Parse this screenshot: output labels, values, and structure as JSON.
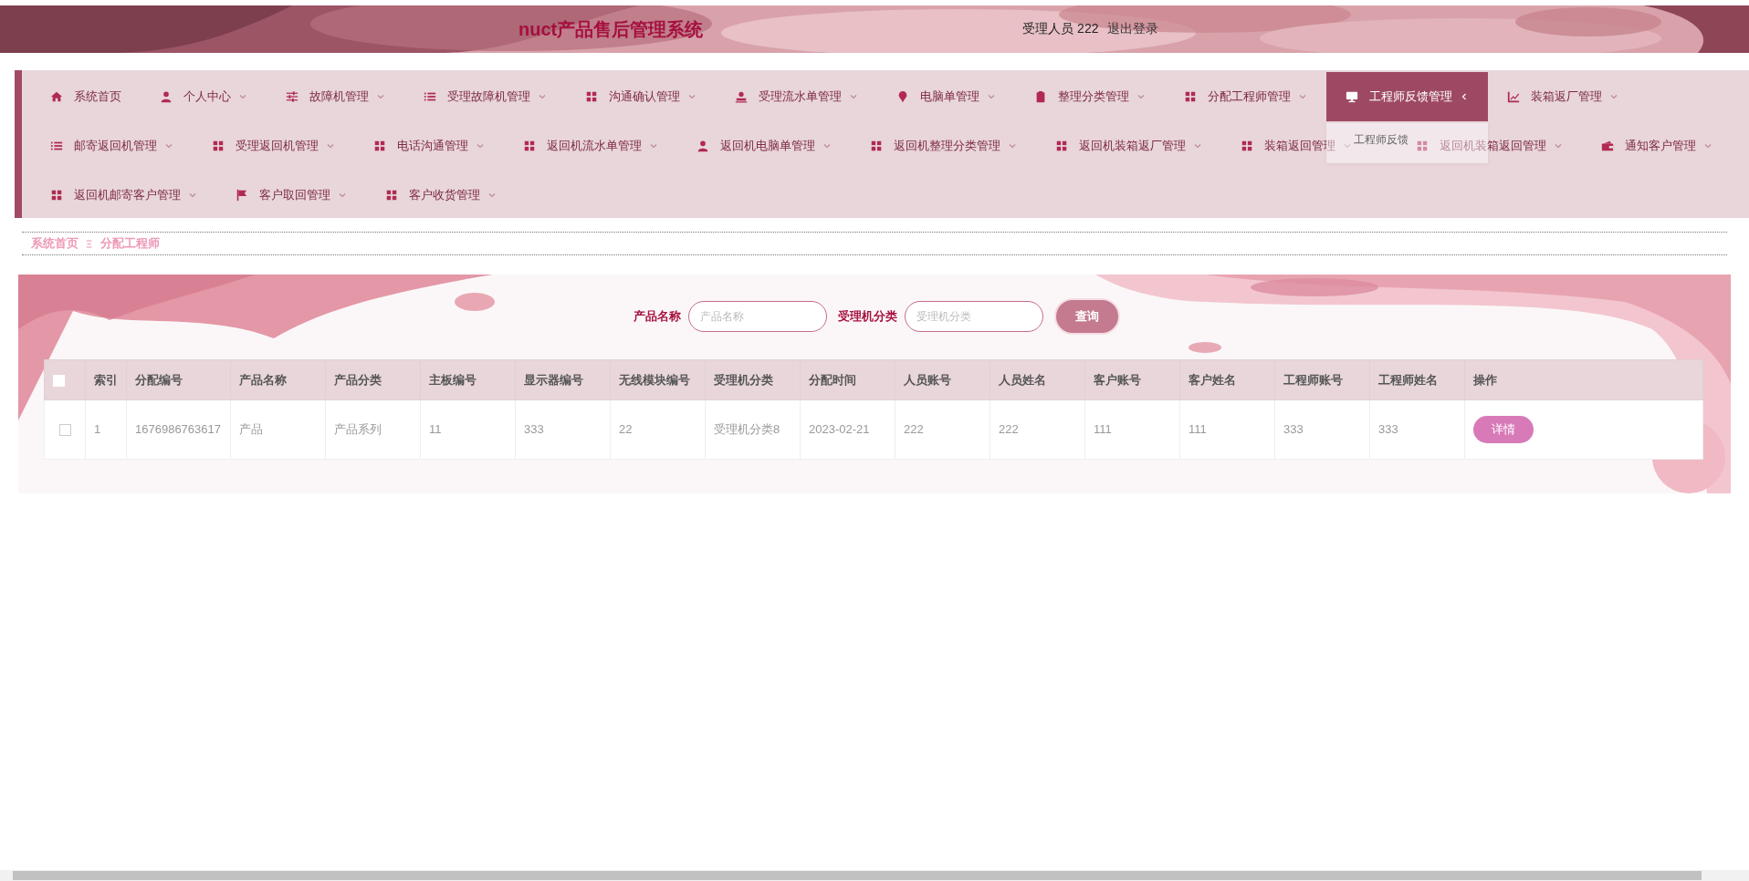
{
  "header": {
    "title": "nuct产品售后管理系统",
    "user_label": "受理人员",
    "user_name": "222",
    "logout": "退出登录"
  },
  "menu_rows": [
    {
      "items": [
        {
          "label": "系统首页",
          "has_submenu": false,
          "selected": false,
          "expanded": false
        },
        {
          "label": "个人中心",
          "has_submenu": true,
          "selected": false,
          "expanded": false
        },
        {
          "label": "故障机管理",
          "has_submenu": true,
          "selected": false,
          "expanded": false
        },
        {
          "label": "受理故障机管理",
          "has_submenu": true,
          "selected": false,
          "expanded": false
        },
        {
          "label": "沟通确认管理",
          "has_submenu": true,
          "selected": false,
          "expanded": false
        },
        {
          "label": "受理流水单管理",
          "has_submenu": true,
          "selected": false,
          "expanded": false
        },
        {
          "label": "电脑单管理",
          "has_submenu": true,
          "selected": false,
          "expanded": false
        },
        {
          "label": "整理分类管理",
          "has_submenu": true,
          "selected": false,
          "expanded": false
        },
        {
          "label": "分配工程师管理",
          "has_submenu": true,
          "selected": false,
          "expanded": false
        },
        {
          "label": "工程师反馈管理",
          "has_submenu": true,
          "selected": true,
          "expanded": true,
          "submenu": [
            "工程师反馈"
          ]
        },
        {
          "label": "装箱返厂管理",
          "has_submenu": true,
          "selected": false,
          "expanded": false
        }
      ]
    },
    {
      "items": [
        {
          "label": "邮寄返回机管理",
          "has_submenu": true,
          "selected": false,
          "expanded": false
        },
        {
          "label": "受理返回机管理",
          "has_submenu": true,
          "selected": false,
          "expanded": false
        },
        {
          "label": "电话沟通管理",
          "has_submenu": true,
          "selected": false,
          "expanded": false
        },
        {
          "label": "返回机流水单管理",
          "has_submenu": true,
          "selected": false,
          "expanded": false
        },
        {
          "label": "返回机电脑单管理",
          "has_submenu": true,
          "selected": false,
          "expanded": false
        },
        {
          "label": "返回机整理分类管理",
          "has_submenu": true,
          "selected": false,
          "expanded": false
        },
        {
          "label": "返回机装箱返厂管理",
          "has_submenu": true,
          "selected": false,
          "expanded": false
        },
        {
          "label": "装箱返回管理",
          "has_submenu": true,
          "selected": false,
          "expanded": false
        },
        {
          "label": "返回机装箱返回管理",
          "has_submenu": true,
          "selected": false,
          "expanded": false
        },
        {
          "label": "通知客户管理",
          "has_submenu": true,
          "selected": false,
          "expanded": false
        }
      ]
    },
    {
      "items": [
        {
          "label": "返回机邮寄客户管理",
          "has_submenu": true,
          "selected": false,
          "expanded": false
        },
        {
          "label": "客户取回管理",
          "has_submenu": true,
          "selected": false,
          "expanded": false
        },
        {
          "label": "客户收货管理",
          "has_submenu": true,
          "selected": false,
          "expanded": false
        }
      ]
    }
  ],
  "breadcrumb": [
    "系统首页",
    "分配工程师"
  ],
  "search": {
    "fields": [
      {
        "label": "产品名称",
        "placeholder": "产品名称"
      },
      {
        "label": "受理机分类",
        "placeholder": "受理机分类"
      }
    ],
    "button": "查询"
  },
  "table": {
    "header_checked": false,
    "columns": [
      "索引",
      "分配编号",
      "产品名称",
      "产品分类",
      "主板编号",
      "显示器编号",
      "无线模块编号",
      "受理机分类",
      "分配时间",
      "人员账号",
      "人员姓名",
      "客户账号",
      "客户姓名",
      "工程师账号",
      "工程师姓名",
      "操作"
    ],
    "rows": [
      {
        "checked": false,
        "cells": [
          "1",
          "1676986763617",
          "产品",
          "产品系列",
          "11",
          "333",
          "22",
          "受理机分类8",
          "2023-02-21",
          "222",
          "222",
          "111",
          "111",
          "333",
          "333"
        ],
        "action": "详情"
      }
    ]
  }
}
